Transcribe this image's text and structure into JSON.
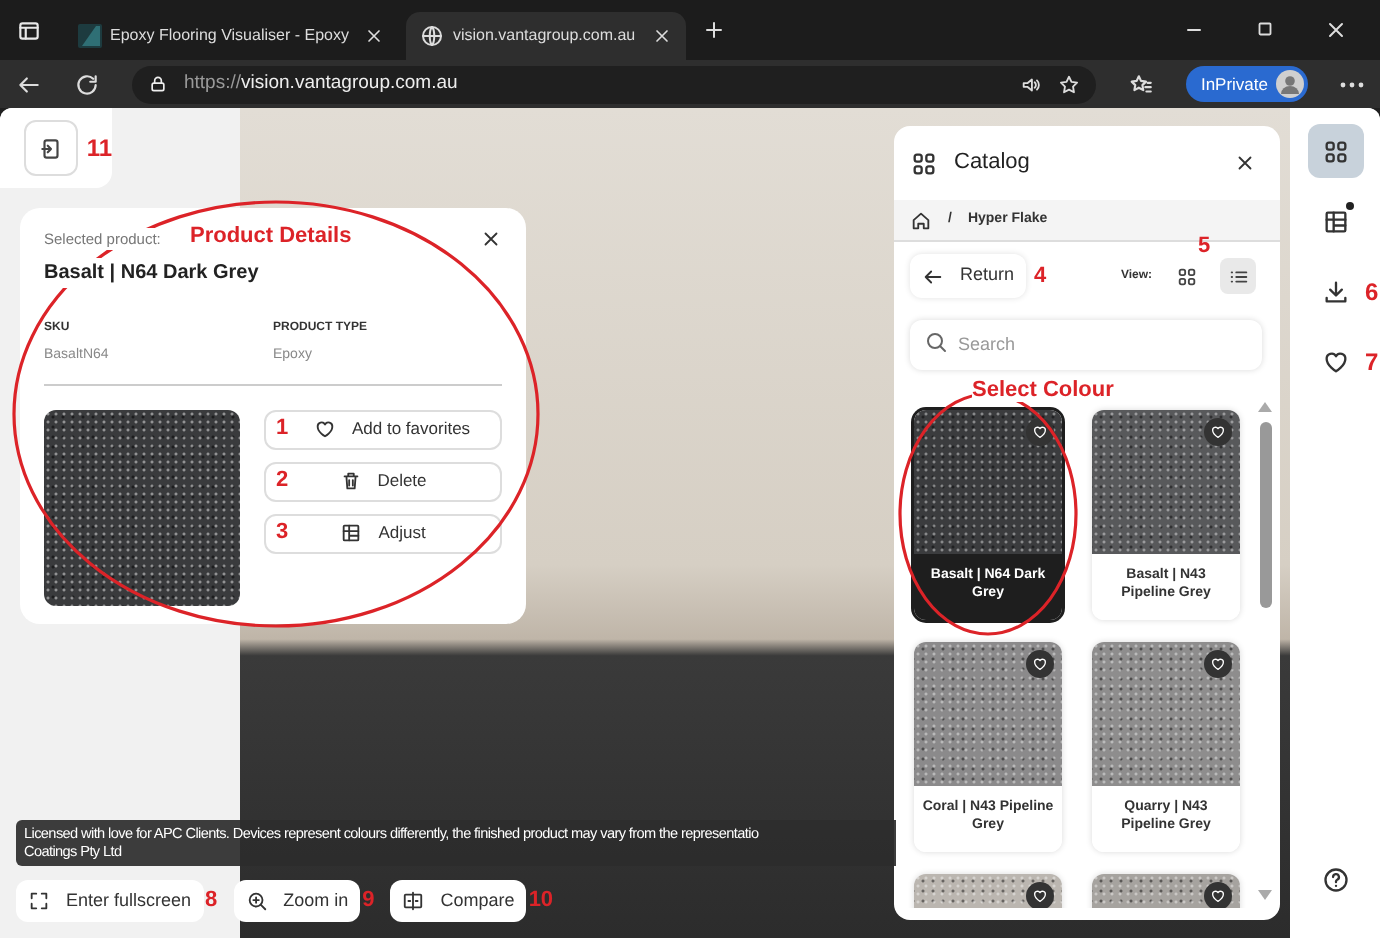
{
  "browser": {
    "tabs": [
      {
        "title": "Epoxy Flooring Visualiser - Epoxy",
        "selected": false
      },
      {
        "title": "vision.vantagroup.com.au",
        "selected": true
      }
    ],
    "url_scheme": "https://",
    "url_host": "vision.vantagroup.com.au",
    "profile_label": "InPrivate"
  },
  "exit_button": {
    "marker": "11"
  },
  "product_details": {
    "annotation": "Product Details",
    "caption": "Selected product:",
    "name": "Basalt | N64 Dark Grey",
    "fields": [
      {
        "label": "SKU",
        "value": "BasaltN64"
      },
      {
        "label": "PRODUCT TYPE",
        "value": "Epoxy"
      }
    ],
    "actions": [
      {
        "kind": "favorite",
        "label": "Add to favorites",
        "marker": "1"
      },
      {
        "kind": "delete",
        "label": "Delete",
        "marker": "2"
      },
      {
        "kind": "adjust",
        "label": "Adjust",
        "marker": "3"
      }
    ]
  },
  "catalog": {
    "title": "Catalog",
    "breadcrumb_separator": "/",
    "breadcrumb": "Hyper Flake",
    "return": {
      "label": "Return",
      "marker": "4"
    },
    "view": {
      "label": "View:",
      "marker": "5",
      "options": [
        {
          "kind": "grid",
          "selected": false
        },
        {
          "kind": "list",
          "selected": true
        }
      ]
    },
    "search_placeholder": "Search",
    "annotation": "Select Colour",
    "items": [
      {
        "name": "Basalt | N64 Dark Grey",
        "color": "#3b3c3e",
        "selected": true,
        "circled": true
      },
      {
        "name": "Basalt | N43 Pipeline Grey",
        "color": "#58595b",
        "selected": false,
        "circled": false
      },
      {
        "name": "Coral | N43 Pipeline Grey",
        "color": "#8b8a8b",
        "selected": false,
        "circled": false
      },
      {
        "name": "Quarry | N43 Pipeline Grey",
        "color": "#8e8d8d",
        "selected": false,
        "circled": false
      },
      {
        "color": "#bbb6b0",
        "selected": false,
        "circled": false
      },
      {
        "color": "#a6a39f",
        "selected": false,
        "circled": false
      }
    ]
  },
  "sidebar": {
    "tools": [
      {
        "kind": "catalog",
        "selected": true,
        "notification": false
      },
      {
        "kind": "layout",
        "selected": false,
        "notification": true
      },
      {
        "kind": "download",
        "selected": false,
        "notification": false,
        "marker": "6"
      },
      {
        "kind": "favorites",
        "selected": false,
        "notification": false,
        "marker": "7"
      },
      {
        "kind": "help",
        "selected": false,
        "notification": false
      }
    ]
  },
  "disclaimer": [
    "Licensed with love for APC Clients. Devices represent colours differently, the finished product may vary from the representatio",
    "Coatings Pty Ltd"
  ],
  "toolbar": [
    {
      "kind": "fullscreen",
      "label": "Enter fullscreen",
      "marker": "8"
    },
    {
      "kind": "zoom",
      "label": "Zoom in",
      "marker": "9"
    },
    {
      "kind": "compare",
      "label": "Compare",
      "marker": "10"
    }
  ]
}
